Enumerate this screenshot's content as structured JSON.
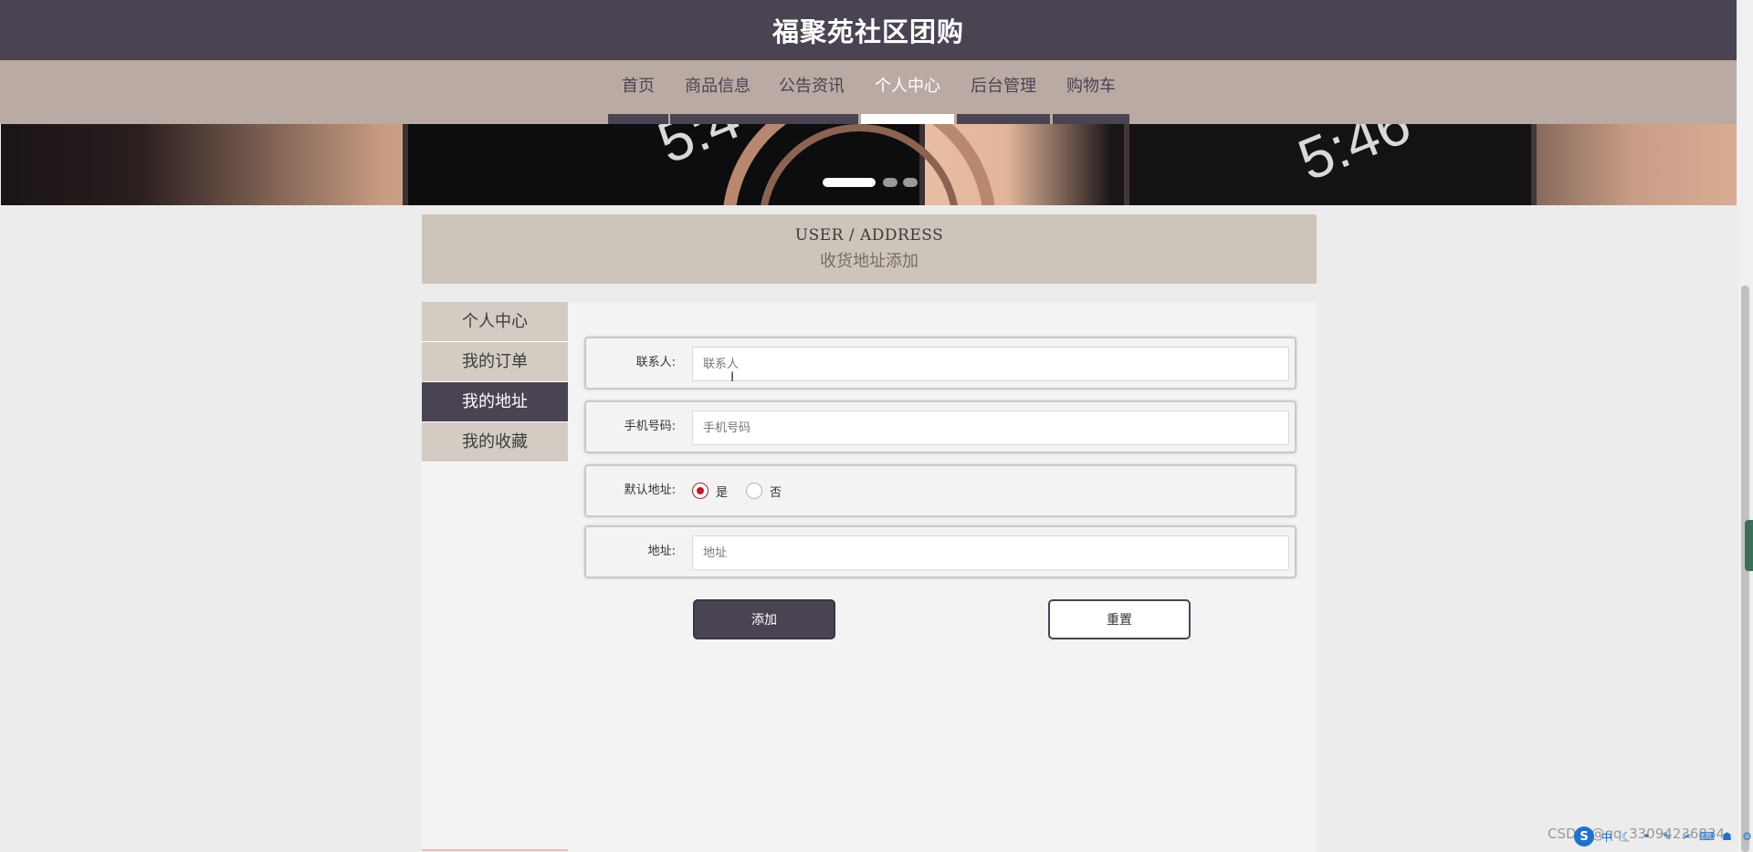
{
  "header": {
    "title": "福聚苑社区团购"
  },
  "nav": {
    "items": [
      {
        "label": "首页"
      },
      {
        "label": "商品信息"
      },
      {
        "label": "公告资讯"
      },
      {
        "label": "个人中心"
      },
      {
        "label": "后台管理"
      },
      {
        "label": "购物车"
      }
    ],
    "active_index": 3
  },
  "banner": {
    "clock_left": "5:4",
    "clock_right": "5:46",
    "slide_count": 3,
    "active_slide": 1
  },
  "page_heading": {
    "en": "USER / ADDRESS",
    "cn": "收货地址添加"
  },
  "sidebar": {
    "items": [
      {
        "label": "个人中心"
      },
      {
        "label": "我的订单"
      },
      {
        "label": "我的地址"
      },
      {
        "label": "我的收藏"
      }
    ],
    "active_index": 2
  },
  "form": {
    "contact": {
      "label": "联系人:",
      "placeholder": "联系人",
      "value": ""
    },
    "phone": {
      "label": "手机号码:",
      "placeholder": "手机号码",
      "value": ""
    },
    "default_address": {
      "label": "默认地址:",
      "options": [
        {
          "label": "是",
          "checked": true
        },
        {
          "label": "否",
          "checked": false
        }
      ]
    },
    "address": {
      "label": "地址:",
      "placeholder": "地址",
      "value": ""
    },
    "add_button": "添加",
    "reset_button": "重置"
  },
  "watermark": "CSDN @qq_33094236834",
  "colors": {
    "header_bg": "#4a4352",
    "nav_bg": "#b9aba3",
    "heading_bg": "#cdc4ba",
    "sidebar_bg": "#d4ccc2",
    "accent": "#4a4352",
    "radio_checked": "#c0182a"
  }
}
